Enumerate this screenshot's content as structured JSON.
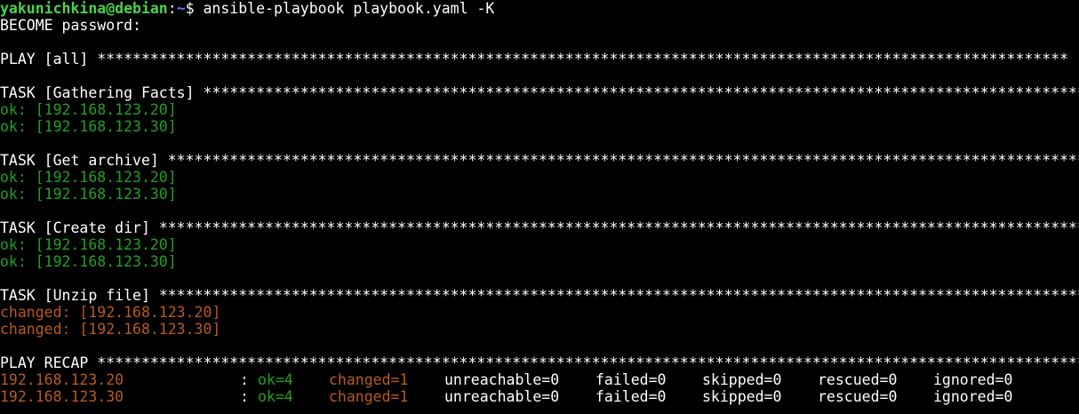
{
  "prompt": {
    "user_host": "yakunichkina@debian",
    "separator": ":",
    "path": "~",
    "symbol": "$ ",
    "command": "ansible-playbook playbook.yaml -K"
  },
  "become_prompt": "BECOME password:",
  "play_header": {
    "label": "PLAY [all] ",
    "stars": "**************************************************************************************************************"
  },
  "tasks": [
    {
      "label": "TASK [Gathering Facts] ",
      "stars": "*******************************************************************************************************",
      "results": [
        "ok: [192.168.123.20]",
        "ok: [192.168.123.30]"
      ]
    },
    {
      "label": "TASK [Get archive] ",
      "stars": "***********************************************************************************************************",
      "results": [
        "ok: [192.168.123.20]",
        "ok: [192.168.123.30]"
      ]
    },
    {
      "label": "TASK [Create dir] ",
      "stars": "************************************************************************************************************",
      "results": [
        "ok: [192.168.123.20]",
        "ok: [192.168.123.30]"
      ]
    },
    {
      "label": "TASK [Unzip file] ",
      "stars": "************************************************************************************************************",
      "results": [
        "changed: [192.168.123.20]",
        "changed: [192.168.123.30]"
      ]
    }
  ],
  "recap_header": {
    "label": "PLAY RECAP ",
    "stars": "******************************************************************************************************************"
  },
  "recap": [
    {
      "host": "192.168.123.20",
      "sep": ": ",
      "ok": "ok=4",
      "changed": "changed=1",
      "unreachable": "unreachable=0",
      "failed": "failed=0",
      "skipped": "skipped=0",
      "rescued": "rescued=0",
      "ignored": "ignored=0"
    },
    {
      "host": "192.168.123.30",
      "sep": ": ",
      "ok": "ok=4",
      "changed": "changed=1",
      "unreachable": "unreachable=0",
      "failed": "failed=0",
      "skipped": "skipped=0",
      "rescued": "rescued=0",
      "ignored": "ignored=0"
    }
  ],
  "colors": {
    "background": "#000000",
    "text": "#ffffff",
    "user_host": "#4ad24a",
    "path": "#5c7cff",
    "ok": "#20a020",
    "changed": "#b85a1c"
  }
}
